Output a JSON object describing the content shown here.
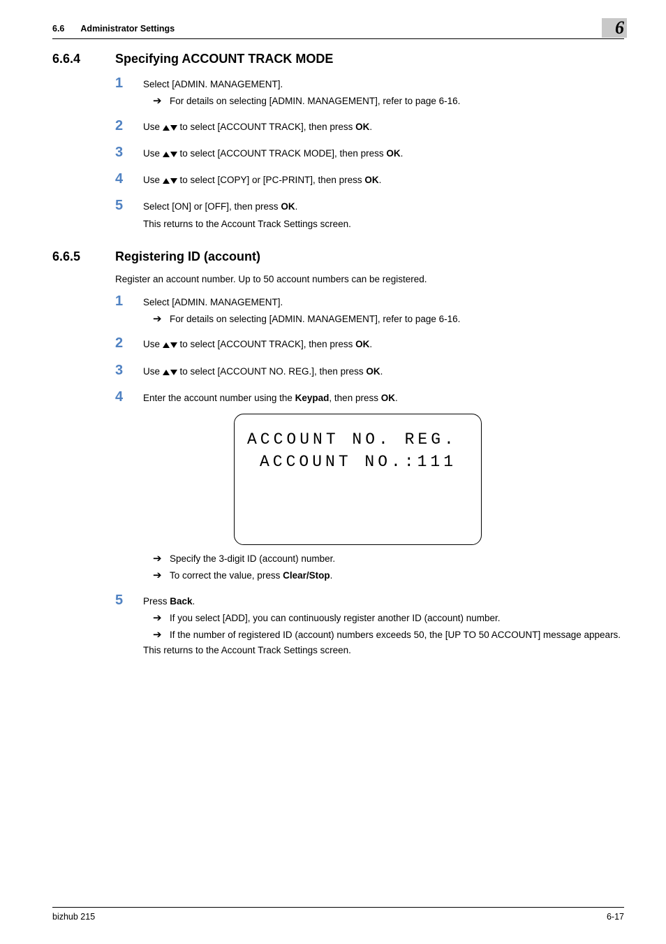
{
  "header": {
    "section_num": "6.6",
    "section_title": "Administrator Settings",
    "chapter": "6"
  },
  "section1": {
    "number": "6.6.4",
    "title": "Specifying ACCOUNT TRACK MODE",
    "steps": {
      "s1": {
        "num": "1",
        "text": "Select [ADMIN. MANAGEMENT].",
        "sub1": "For details on selecting [ADMIN. MANAGEMENT], refer to page 6-16."
      },
      "s2": {
        "num": "2",
        "pre": "Use ",
        "post": " to select [ACCOUNT TRACK], then press ",
        "bold": "OK",
        "tail": "."
      },
      "s3": {
        "num": "3",
        "pre": "Use ",
        "post": " to select [ACCOUNT TRACK MODE], then press ",
        "bold": "OK",
        "tail": "."
      },
      "s4": {
        "num": "4",
        "pre": "Use ",
        "post": " to select [COPY] or [PC-PRINT], then press ",
        "bold": "OK",
        "tail": "."
      },
      "s5": {
        "num": "5",
        "l1a": "Select [ON] or [OFF], then press ",
        "l1b": "OK",
        "l1c": ".",
        "l2": "This returns to the Account Track Settings screen."
      }
    }
  },
  "section2": {
    "number": "6.6.5",
    "title": "Registering ID (account)",
    "intro": "Register an account number. Up to 50 account numbers can be registered.",
    "steps": {
      "s1": {
        "num": "1",
        "text": "Select [ADMIN. MANAGEMENT].",
        "sub1": "For details on selecting [ADMIN. MANAGEMENT], refer to page 6-16."
      },
      "s2": {
        "num": "2",
        "pre": "Use ",
        "post": " to select [ACCOUNT TRACK], then press ",
        "bold": "OK",
        "tail": "."
      },
      "s3": {
        "num": "3",
        "pre": "Use ",
        "post": " to select [ACCOUNT NO. REG.], then press ",
        "bold": "OK",
        "tail": "."
      },
      "s4": {
        "num": "4",
        "pre": "Enter the account number using the ",
        "bold1": "Keypad",
        "mid": ", then press ",
        "bold2": "OK",
        "tail": ".",
        "lcd1": "ACCOUNT NO. REG.",
        "lcd2": "ACCOUNT NO.:111",
        "sub1": "Specify the 3-digit ID (account) number.",
        "sub2a": "To correct the value, press ",
        "sub2b": "Clear/Stop",
        "sub2c": "."
      },
      "s5": {
        "num": "5",
        "l1a": "Press ",
        "l1b": "Back",
        "l1c": ".",
        "sub1": "If you select [ADD], you can continuously register another ID (account) number.",
        "sub2": "If the number of registered ID (account) numbers exceeds 50, the [UP TO 50 ACCOUNT] message appears.",
        "l2": "This returns to the Account Track Settings screen."
      }
    }
  },
  "footer": {
    "left": "bizhub 215",
    "right": "6-17"
  }
}
